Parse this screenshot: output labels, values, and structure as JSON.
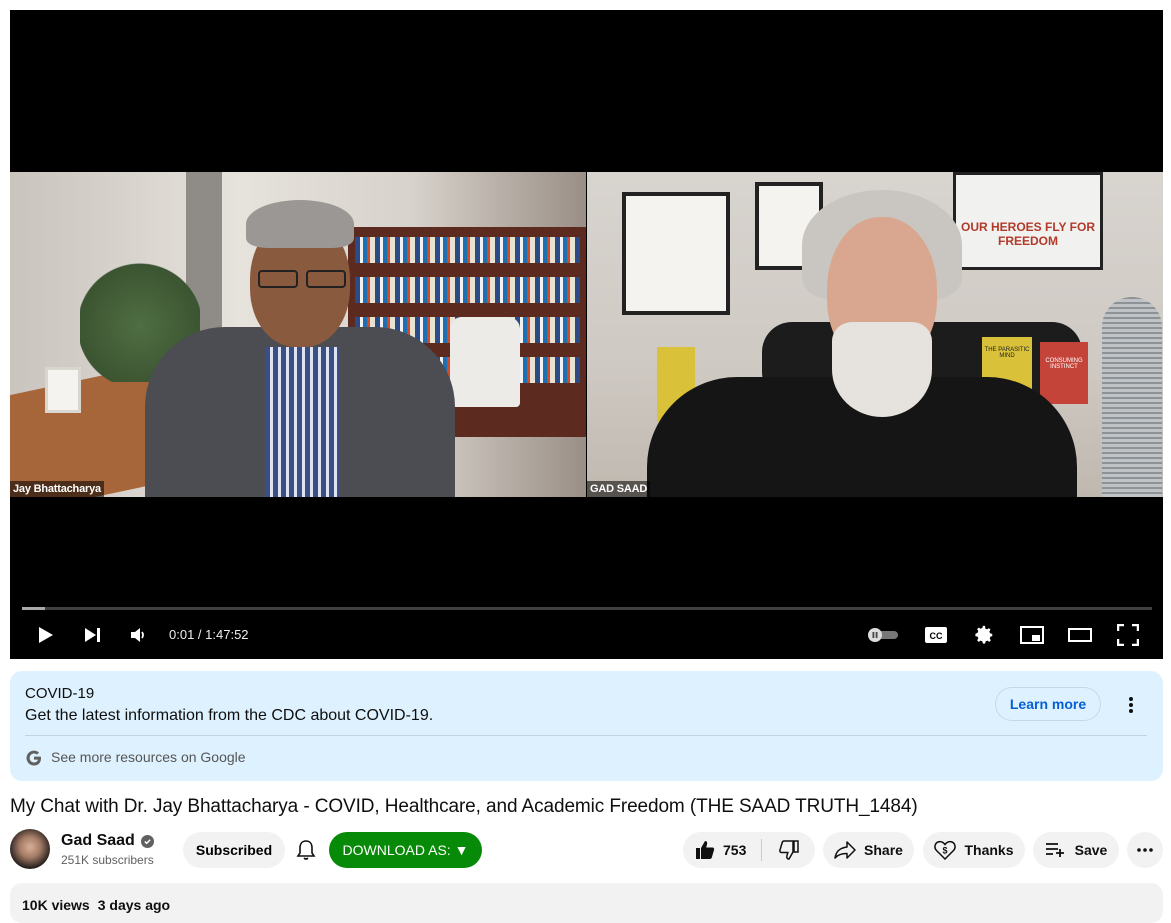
{
  "player": {
    "participants": [
      "Jay Bhattacharya",
      "GAD SAAD"
    ],
    "poster_text": "OUR HEROES FLY FOR FREEDOM",
    "book_titles": [
      "THE PARASITIC MIND",
      "CONSUMING INSTINCT"
    ],
    "time_current": "0:01",
    "time_total": "1:47:52",
    "progress_fraction": 0.02,
    "cc_label": "CC"
  },
  "covid_panel": {
    "title": "COVID-19",
    "description": "Get the latest information from the CDC about COVID-19.",
    "learn_more": "Learn more",
    "more_resources": "See more resources on Google"
  },
  "video": {
    "title": "My Chat with Dr. Jay Bhattacharya - COVID, Healthcare, and Academic Freedom (THE SAAD TRUTH_1484)"
  },
  "channel": {
    "name": "Gad Saad",
    "subscribers": "251K subscribers",
    "subscribed_label": "Subscribed",
    "download_label": "DOWNLOAD AS: ▼"
  },
  "actions": {
    "likes": "753",
    "share": "Share",
    "thanks": "Thanks",
    "save": "Save"
  },
  "description": {
    "views": "10K views",
    "age": "3 days ago"
  },
  "colors": {
    "download_green": "#078a07",
    "covid_bg": "#def1ff",
    "link_blue": "#065fd4"
  }
}
